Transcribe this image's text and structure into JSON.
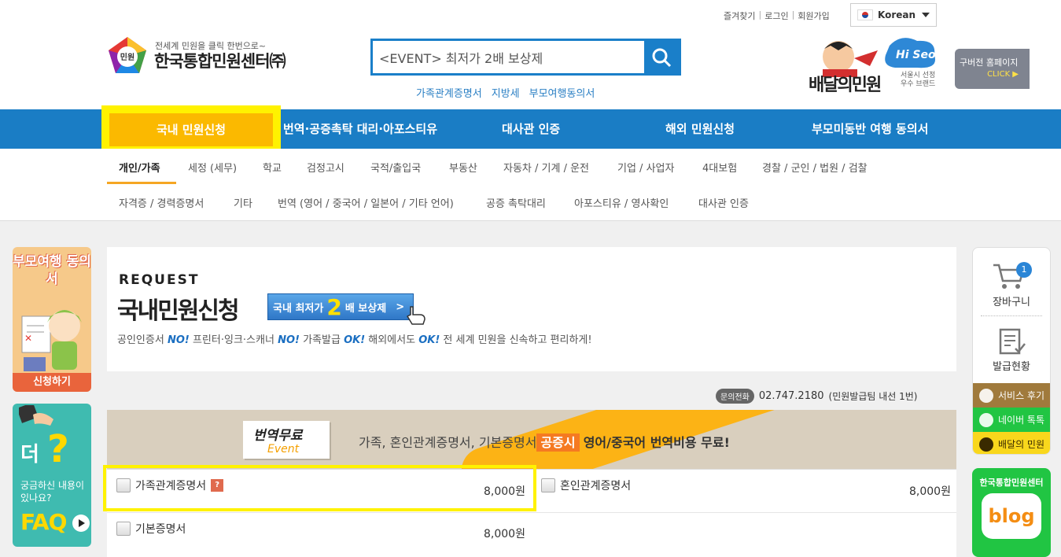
{
  "header": {
    "top_links": [
      "즐겨찾기",
      "로그인",
      "회원가입"
    ],
    "language": "Korean",
    "logo_mark_text": "민원",
    "logo_subtitle": "전세계 민원을 클릭 한번으로~",
    "logo_title": "한국통합민원센터㈜",
    "search_value": "<EVENT> 최저가 2배 보상제",
    "quick_links": [
      "가족관계증명서",
      "지방세",
      "부모여행동의서"
    ],
    "brand_text": "배달의민원",
    "brand_hi": "Hi Seoul",
    "brand_sub": "서울시 선정 우수 브랜드",
    "old_home": "구버전 홈페이지",
    "old_home_click": "CLICK"
  },
  "main_nav": {
    "items": [
      "국내 민원신청",
      "번역·공증촉탁 대리·아포스티유",
      "대사관 인증",
      "해외 민원신청",
      "부모미동반 여행 동의서"
    ]
  },
  "sub_nav": {
    "row1": [
      "개인/가족",
      "세정 (세무)",
      "학교",
      "검정고시",
      "국적/출입국",
      "부동산",
      "자동차 / 기계 / 운전",
      "기업 / 사업자",
      "4대보험",
      "경찰 / 군인 / 법원 / 검찰"
    ],
    "row2": [
      "자격증 / 경력증명서",
      "기타",
      "번역 (영어 / 중국어 / 일본어 / 기타 언어)",
      "공증 촉탁대리",
      "아포스티유 / 영사확인",
      "대사관 인증"
    ]
  },
  "left_banners": {
    "banner1_title": "부모여행 동의서",
    "banner1_button": "신청하기",
    "banner2_big": "더",
    "banner2_text": "궁금하신 내용이 있나요?",
    "banner2_faq": "FAQ"
  },
  "request": {
    "label": "REQUEST",
    "title": "국내민원신청",
    "badge_prefix": "국내 최저가",
    "badge_two": "2",
    "badge_suffix": "배 보상제",
    "badge_arrow": ">",
    "desc_parts": [
      "공인인증서",
      "NO!",
      "프린터·잉크·스캐너",
      "NO!",
      "가족발급",
      "OK!",
      "해외에서도",
      "OK!",
      "전 세계 민원을 신속하고 편리하게!"
    ]
  },
  "phone": {
    "tag": "문의전화",
    "number": "02.747.2180",
    "note": "(민원발급팀 내선 1번)"
  },
  "event": {
    "title": "번역무료",
    "subtitle": "Event",
    "text_before": "가족, 혼인관계증명서, 기본증명서",
    "highlight": "공증시",
    "text_after": "영어/중국어 번역비용 무료!"
  },
  "items": [
    {
      "name": "가족관계증명서",
      "price": "8,000원",
      "help": "?"
    },
    {
      "name": "혼인관계증명서",
      "price": "8,000원"
    },
    {
      "name": "기본증명서",
      "price": "8,000원"
    }
  ],
  "right_sidebar": {
    "cart_label": "장바구니",
    "cart_count": "1",
    "issue_label": "발급현황",
    "buttons": [
      {
        "label": "서비스 후기",
        "color": "#a07a3c"
      },
      {
        "label": "네이버 톡톡",
        "color": "#21c543"
      },
      {
        "label": "배달의 민원",
        "color": "#f9d71c"
      }
    ],
    "blog_title": "한국통합민원센터",
    "blog_text": "blog"
  },
  "colors": {
    "primary_blue": "#1a7dc5",
    "active_tab": "#fbb900",
    "highlight_yellow": "#fff200"
  }
}
